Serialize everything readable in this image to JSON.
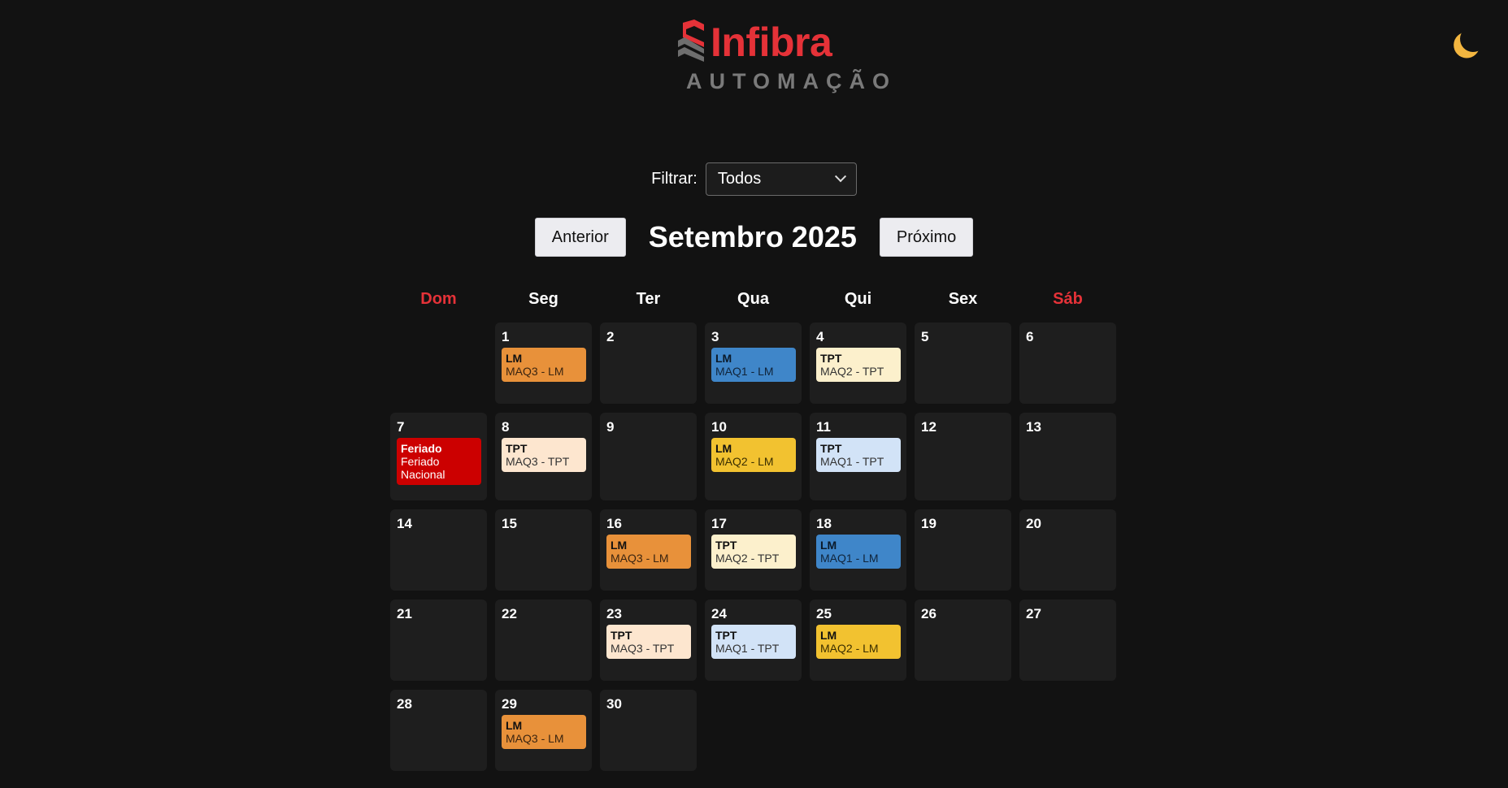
{
  "brand": {
    "name": "Infibra",
    "subtitle": "AUTOMAÇÃO",
    "color": "#e53238"
  },
  "theme_toggle": {
    "icon": "moon-icon"
  },
  "filter": {
    "label": "Filtrar:",
    "selected": "Todos"
  },
  "nav": {
    "prev_label": "Anterior",
    "month_title": "Setembro 2025",
    "next_label": "Próximo"
  },
  "weekdays": [
    "Dom",
    "Seg",
    "Ter",
    "Qua",
    "Qui",
    "Sex",
    "Sáb"
  ],
  "weeks": [
    [
      {
        "day": ""
      },
      {
        "day": "1",
        "event": {
          "title": "LM",
          "sub": "MAQ3 - LM",
          "style": "orange"
        }
      },
      {
        "day": "2"
      },
      {
        "day": "3",
        "event": {
          "title": "LM",
          "sub": "MAQ1 - LM",
          "style": "blue"
        }
      },
      {
        "day": "4",
        "event": {
          "title": "TPT",
          "sub": "MAQ2 - TPT",
          "style": "cream"
        }
      },
      {
        "day": "5"
      },
      {
        "day": "6"
      }
    ],
    [
      {
        "day": "7",
        "event": {
          "title": "Feriado",
          "sub": "Feriado Nacional",
          "style": "red"
        }
      },
      {
        "day": "8",
        "event": {
          "title": "TPT",
          "sub": "MAQ3 - TPT",
          "style": "peach"
        }
      },
      {
        "day": "9"
      },
      {
        "day": "10",
        "event": {
          "title": "LM",
          "sub": "MAQ2 - LM",
          "style": "yellow"
        }
      },
      {
        "day": "11",
        "event": {
          "title": "TPT",
          "sub": "MAQ1 - TPT",
          "style": "lightblue"
        }
      },
      {
        "day": "12"
      },
      {
        "day": "13"
      }
    ],
    [
      {
        "day": "14"
      },
      {
        "day": "15"
      },
      {
        "day": "16",
        "event": {
          "title": "LM",
          "sub": "MAQ3 - LM",
          "style": "orange"
        }
      },
      {
        "day": "17",
        "event": {
          "title": "TPT",
          "sub": "MAQ2 - TPT",
          "style": "cream"
        }
      },
      {
        "day": "18",
        "event": {
          "title": "LM",
          "sub": "MAQ1 - LM",
          "style": "blue"
        }
      },
      {
        "day": "19"
      },
      {
        "day": "20"
      }
    ],
    [
      {
        "day": "21"
      },
      {
        "day": "22"
      },
      {
        "day": "23",
        "event": {
          "title": "TPT",
          "sub": "MAQ3 - TPT",
          "style": "peach"
        }
      },
      {
        "day": "24",
        "event": {
          "title": "TPT",
          "sub": "MAQ1 - TPT",
          "style": "lightblue"
        }
      },
      {
        "day": "25",
        "event": {
          "title": "LM",
          "sub": "MAQ2 - LM",
          "style": "yellow"
        }
      },
      {
        "day": "26"
      },
      {
        "day": "27"
      }
    ],
    [
      {
        "day": "28"
      },
      {
        "day": "29",
        "event": {
          "title": "LM",
          "sub": "MAQ3 - LM",
          "style": "orange"
        }
      },
      {
        "day": "30"
      },
      {
        "day": ""
      },
      {
        "day": ""
      },
      {
        "day": ""
      },
      {
        "day": ""
      }
    ]
  ],
  "colors": {
    "orange": "#e8913a",
    "blue": "#3f86c9",
    "cream": "#fcf0cc",
    "peach": "#fde6cf",
    "yellow": "#f2c230",
    "lightblue": "#d2e3f7",
    "red": "#cc0000",
    "weekend_header": "#e53238"
  }
}
